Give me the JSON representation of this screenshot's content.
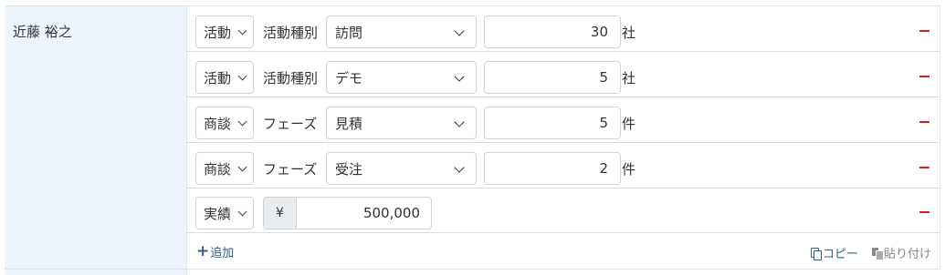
{
  "person": {
    "name": "近藤 裕之"
  },
  "rows": [
    {
      "category": "活動",
      "kind_label": "活動種別",
      "selected": "訪問",
      "value": "30",
      "unit": "社"
    },
    {
      "category": "活動",
      "kind_label": "活動種別",
      "selected": "デモ",
      "value": "5",
      "unit": "社"
    },
    {
      "category": "商談",
      "kind_label": "フェーズ",
      "selected": "見積",
      "value": "5",
      "unit": "件"
    },
    {
      "category": "商談",
      "kind_label": "フェーズ",
      "selected": "受注",
      "value": "2",
      "unit": "件"
    }
  ],
  "result_row": {
    "category": "実績",
    "currency_symbol": "¥",
    "amount": "500,000"
  },
  "footer": {
    "add_label": "追加",
    "copy_label": "コピー",
    "paste_label": "貼り付け"
  },
  "colors": {
    "remove": "#e2172b",
    "link": "#2f5f8a",
    "name_cell_bg": "#eef4fb"
  },
  "icons": {
    "remove": "minus-icon",
    "add": "plus-icon",
    "copy": "copy-icon",
    "paste": "paste-icon",
    "dropdown": "chevron-down-icon"
  }
}
